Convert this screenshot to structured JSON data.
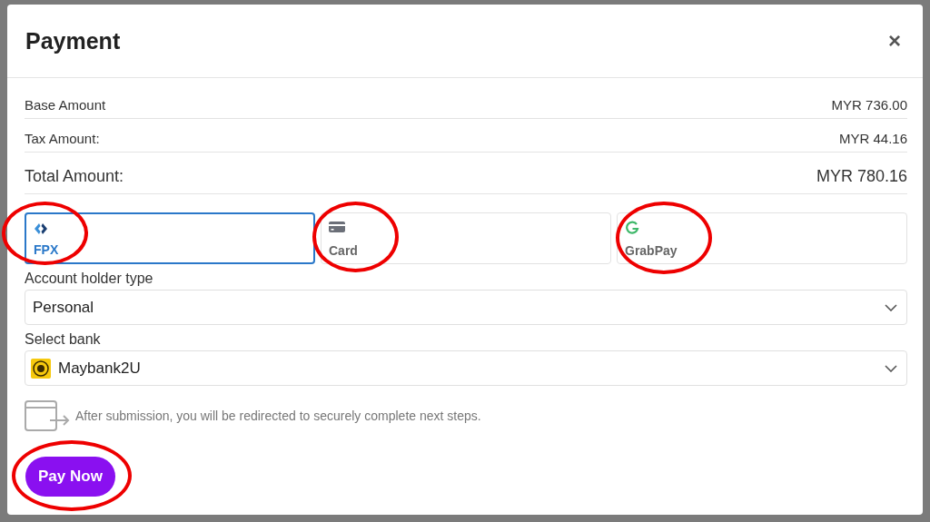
{
  "dialog": {
    "title": "Payment",
    "close": "×"
  },
  "amounts": [
    {
      "label": "Base Amount",
      "value": "MYR 736.00",
      "kind": "line"
    },
    {
      "label": "Tax Amount:",
      "value": "MYR 44.16",
      "kind": "line"
    },
    {
      "label": "Total Amount:",
      "value": "MYR 780.16",
      "kind": "total"
    }
  ],
  "methods": [
    {
      "label": "FPX",
      "kind": "fpx",
      "selected": true,
      "circled": true
    },
    {
      "label": "Card",
      "kind": "card",
      "selected": false,
      "circled": true
    },
    {
      "label": "GrabPay",
      "kind": "grabpay",
      "selected": false,
      "circled": true
    }
  ],
  "fields": [
    {
      "label": "Account holder type",
      "value": "Personal",
      "kind": "plain"
    },
    {
      "label": "Select bank",
      "value": "Maybank2U",
      "kind": "bank"
    }
  ],
  "note": "After submission, you will be redirected to securely complete next steps.",
  "pay_button": {
    "label": "Pay Now",
    "circled": true
  }
}
